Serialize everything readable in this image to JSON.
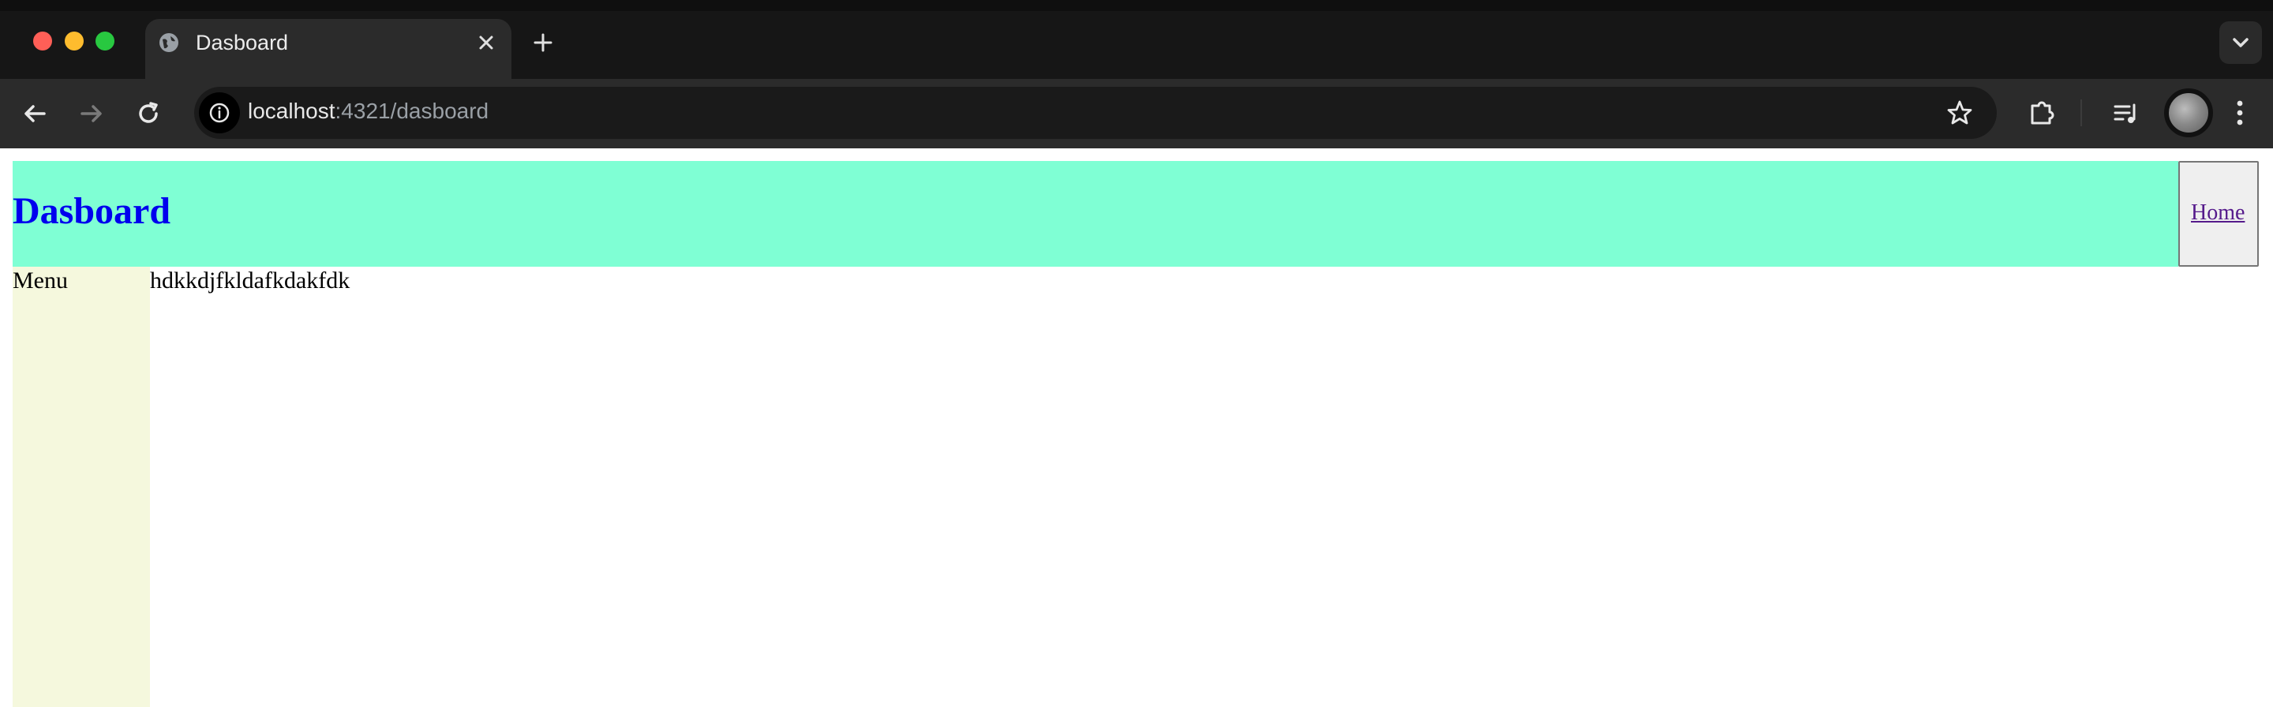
{
  "browser": {
    "tab_title": "Dasboard",
    "url_host": "localhost",
    "url_path": ":4321/dasboard"
  },
  "icons": {
    "tab_favicon": "globe-icon",
    "tab_close": "close-icon",
    "new_tab": "plus-icon",
    "tab_search": "chevron-down-icon",
    "back": "arrow-left-icon",
    "forward": "arrow-right-icon",
    "reload": "reload-icon",
    "site_info": "info-icon",
    "bookmark": "star-icon",
    "extensions": "puzzle-icon",
    "media": "media-control-icon",
    "profile": "avatar",
    "menu": "kebab-menu-icon"
  },
  "page": {
    "title": "Dasboard",
    "home_link": "Home",
    "sidebar_label": "Menu",
    "content": "hdkkdjfkldafkdakfdk"
  },
  "colors": {
    "header_bg": "#7fffd4",
    "title_color": "#0000ee",
    "sidebar_bg": "#f5f8dd",
    "link_color": "#551a8b"
  }
}
